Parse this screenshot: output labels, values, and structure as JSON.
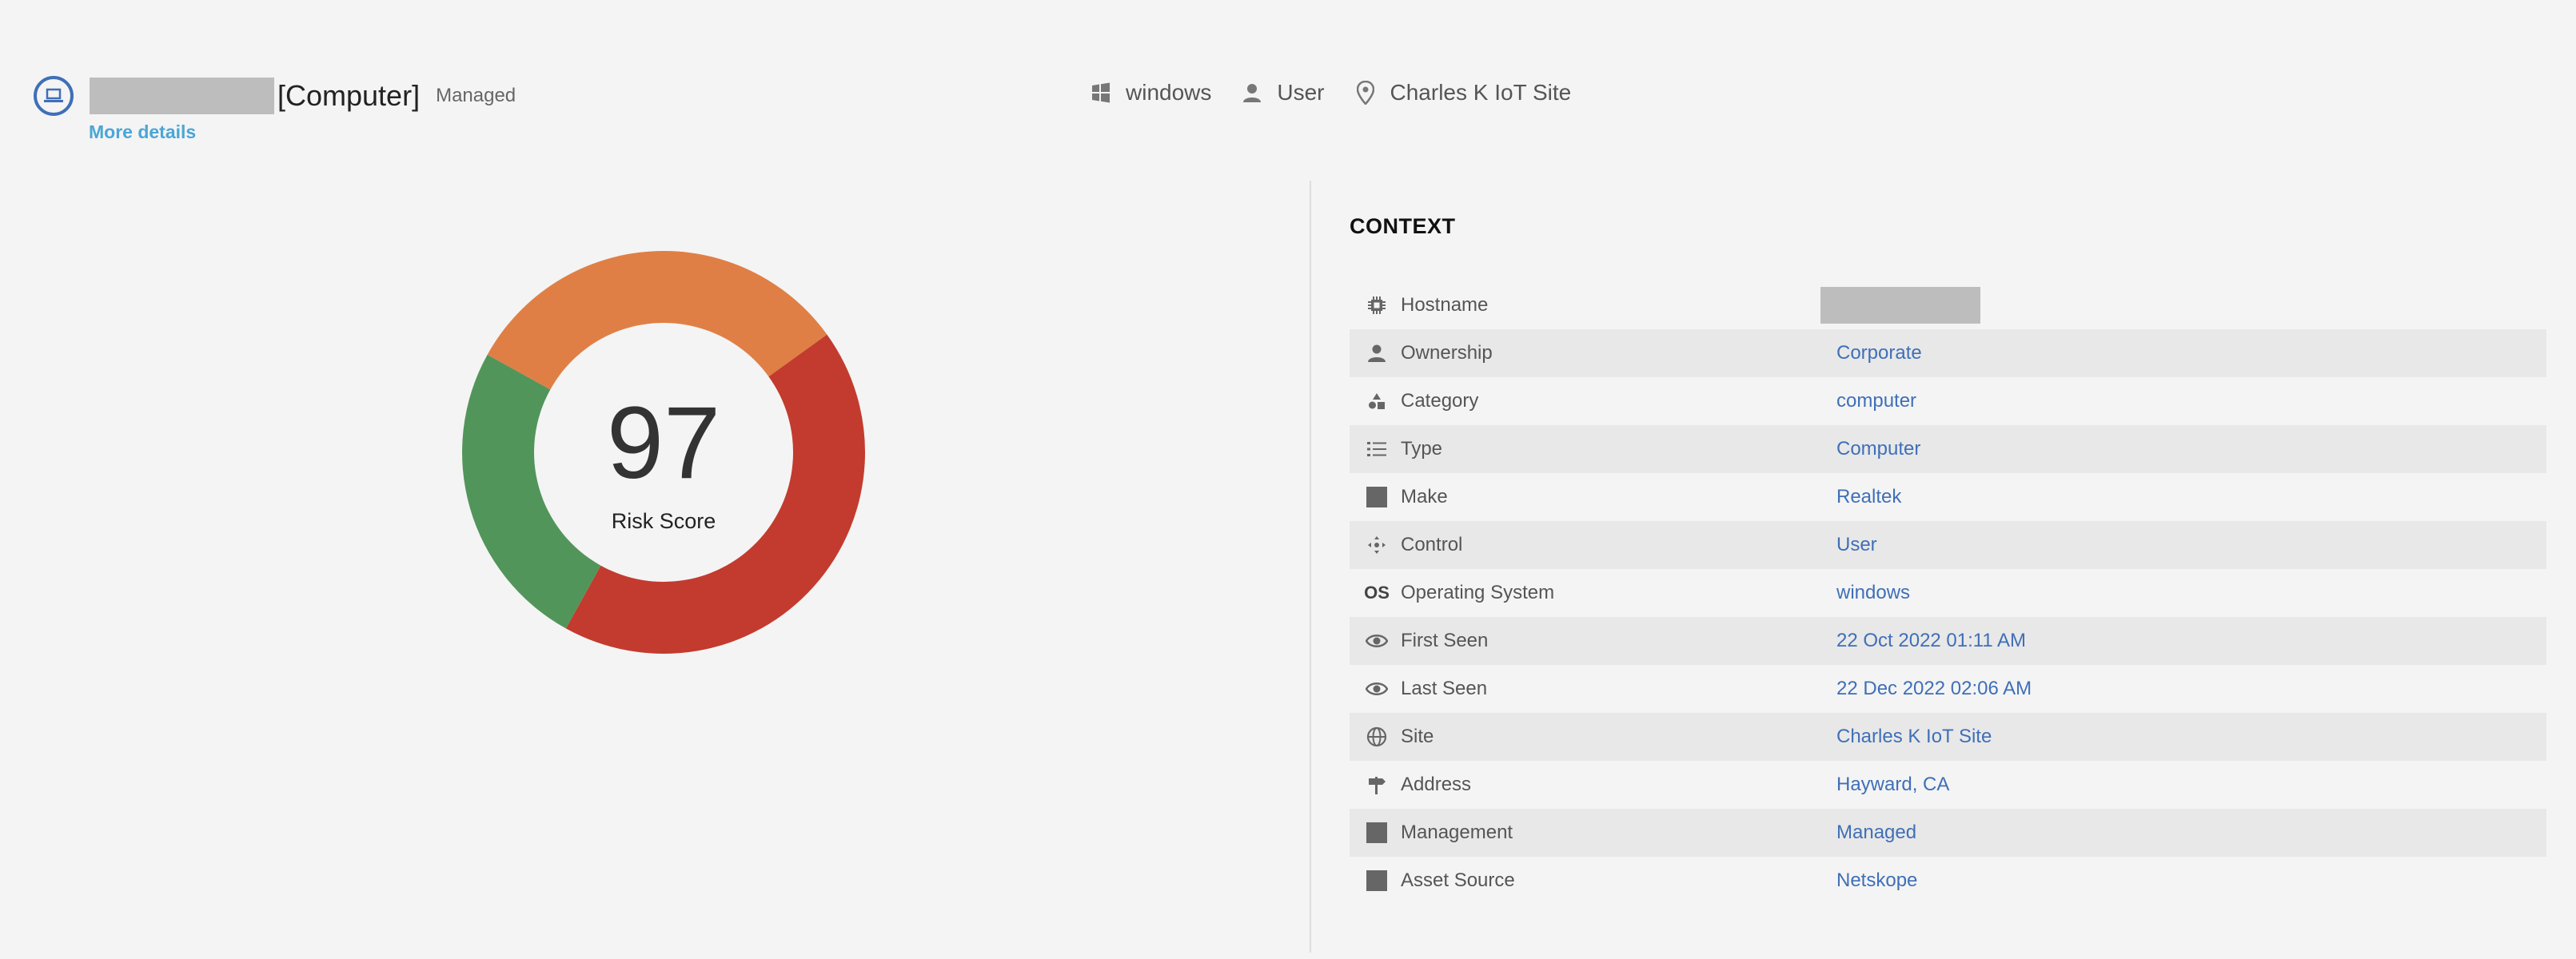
{
  "header": {
    "device_type": "[Computer]",
    "managed_label": "Managed",
    "more_details": "More details"
  },
  "summary": {
    "os": "windows",
    "control": "User",
    "site": "Charles K IoT Site"
  },
  "risk": {
    "score": "97",
    "label": "Risk Score",
    "segments": [
      {
        "color": "#e07f45",
        "fraction": 0.32
      },
      {
        "color": "#c33b2e",
        "fraction": 0.43
      },
      {
        "color": "#52955a",
        "fraction": 0.25
      }
    ]
  },
  "context": {
    "title": "CONTEXT",
    "rows": [
      {
        "label": "Hostname",
        "value": "",
        "icon": "chip-icon"
      },
      {
        "label": "Ownership",
        "value": "Corporate",
        "icon": "person-icon"
      },
      {
        "label": "Category",
        "value": "computer",
        "icon": "shapes-icon"
      },
      {
        "label": "Type",
        "value": "Computer",
        "icon": "list-icon"
      },
      {
        "label": "Make",
        "value": "Realtek",
        "icon": "square-icon"
      },
      {
        "label": "Control",
        "value": "User",
        "icon": "move-icon"
      },
      {
        "label": "Operating System",
        "value": "windows",
        "icon": "os-icon",
        "icon_text": "OS"
      },
      {
        "label": "First Seen",
        "value": "22 Oct 2022 01:11 AM",
        "icon": "eye-icon"
      },
      {
        "label": "Last Seen",
        "value": "22 Dec 2022 02:06 AM",
        "icon": "eye-icon"
      },
      {
        "label": "Site",
        "value": "Charles K IoT Site",
        "icon": "globe-icon"
      },
      {
        "label": "Address",
        "value": "Hayward, CA",
        "icon": "signpost-icon"
      },
      {
        "label": "Management",
        "value": "Managed",
        "icon": "square-icon"
      },
      {
        "label": "Asset Source",
        "value": "Netskope",
        "icon": "square-icon"
      }
    ]
  }
}
